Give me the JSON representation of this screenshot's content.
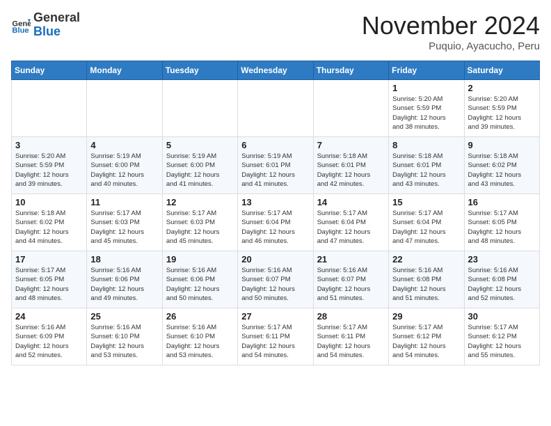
{
  "header": {
    "logo_general": "General",
    "logo_blue": "Blue",
    "month_title": "November 2024",
    "subtitle": "Puquio, Ayacucho, Peru"
  },
  "weekdays": [
    "Sunday",
    "Monday",
    "Tuesday",
    "Wednesday",
    "Thursday",
    "Friday",
    "Saturday"
  ],
  "weeks": [
    [
      {
        "day": "",
        "info": ""
      },
      {
        "day": "",
        "info": ""
      },
      {
        "day": "",
        "info": ""
      },
      {
        "day": "",
        "info": ""
      },
      {
        "day": "",
        "info": ""
      },
      {
        "day": "1",
        "info": "Sunrise: 5:20 AM\nSunset: 5:59 PM\nDaylight: 12 hours\nand 38 minutes."
      },
      {
        "day": "2",
        "info": "Sunrise: 5:20 AM\nSunset: 5:59 PM\nDaylight: 12 hours\nand 39 minutes."
      }
    ],
    [
      {
        "day": "3",
        "info": "Sunrise: 5:20 AM\nSunset: 5:59 PM\nDaylight: 12 hours\nand 39 minutes."
      },
      {
        "day": "4",
        "info": "Sunrise: 5:19 AM\nSunset: 6:00 PM\nDaylight: 12 hours\nand 40 minutes."
      },
      {
        "day": "5",
        "info": "Sunrise: 5:19 AM\nSunset: 6:00 PM\nDaylight: 12 hours\nand 41 minutes."
      },
      {
        "day": "6",
        "info": "Sunrise: 5:19 AM\nSunset: 6:01 PM\nDaylight: 12 hours\nand 41 minutes."
      },
      {
        "day": "7",
        "info": "Sunrise: 5:18 AM\nSunset: 6:01 PM\nDaylight: 12 hours\nand 42 minutes."
      },
      {
        "day": "8",
        "info": "Sunrise: 5:18 AM\nSunset: 6:01 PM\nDaylight: 12 hours\nand 43 minutes."
      },
      {
        "day": "9",
        "info": "Sunrise: 5:18 AM\nSunset: 6:02 PM\nDaylight: 12 hours\nand 43 minutes."
      }
    ],
    [
      {
        "day": "10",
        "info": "Sunrise: 5:18 AM\nSunset: 6:02 PM\nDaylight: 12 hours\nand 44 minutes."
      },
      {
        "day": "11",
        "info": "Sunrise: 5:17 AM\nSunset: 6:03 PM\nDaylight: 12 hours\nand 45 minutes."
      },
      {
        "day": "12",
        "info": "Sunrise: 5:17 AM\nSunset: 6:03 PM\nDaylight: 12 hours\nand 45 minutes."
      },
      {
        "day": "13",
        "info": "Sunrise: 5:17 AM\nSunset: 6:04 PM\nDaylight: 12 hours\nand 46 minutes."
      },
      {
        "day": "14",
        "info": "Sunrise: 5:17 AM\nSunset: 6:04 PM\nDaylight: 12 hours\nand 47 minutes."
      },
      {
        "day": "15",
        "info": "Sunrise: 5:17 AM\nSunset: 6:04 PM\nDaylight: 12 hours\nand 47 minutes."
      },
      {
        "day": "16",
        "info": "Sunrise: 5:17 AM\nSunset: 6:05 PM\nDaylight: 12 hours\nand 48 minutes."
      }
    ],
    [
      {
        "day": "17",
        "info": "Sunrise: 5:17 AM\nSunset: 6:05 PM\nDaylight: 12 hours\nand 48 minutes."
      },
      {
        "day": "18",
        "info": "Sunrise: 5:16 AM\nSunset: 6:06 PM\nDaylight: 12 hours\nand 49 minutes."
      },
      {
        "day": "19",
        "info": "Sunrise: 5:16 AM\nSunset: 6:06 PM\nDaylight: 12 hours\nand 50 minutes."
      },
      {
        "day": "20",
        "info": "Sunrise: 5:16 AM\nSunset: 6:07 PM\nDaylight: 12 hours\nand 50 minutes."
      },
      {
        "day": "21",
        "info": "Sunrise: 5:16 AM\nSunset: 6:07 PM\nDaylight: 12 hours\nand 51 minutes."
      },
      {
        "day": "22",
        "info": "Sunrise: 5:16 AM\nSunset: 6:08 PM\nDaylight: 12 hours\nand 51 minutes."
      },
      {
        "day": "23",
        "info": "Sunrise: 5:16 AM\nSunset: 6:08 PM\nDaylight: 12 hours\nand 52 minutes."
      }
    ],
    [
      {
        "day": "24",
        "info": "Sunrise: 5:16 AM\nSunset: 6:09 PM\nDaylight: 12 hours\nand 52 minutes."
      },
      {
        "day": "25",
        "info": "Sunrise: 5:16 AM\nSunset: 6:10 PM\nDaylight: 12 hours\nand 53 minutes."
      },
      {
        "day": "26",
        "info": "Sunrise: 5:16 AM\nSunset: 6:10 PM\nDaylight: 12 hours\nand 53 minutes."
      },
      {
        "day": "27",
        "info": "Sunrise: 5:17 AM\nSunset: 6:11 PM\nDaylight: 12 hours\nand 54 minutes."
      },
      {
        "day": "28",
        "info": "Sunrise: 5:17 AM\nSunset: 6:11 PM\nDaylight: 12 hours\nand 54 minutes."
      },
      {
        "day": "29",
        "info": "Sunrise: 5:17 AM\nSunset: 6:12 PM\nDaylight: 12 hours\nand 54 minutes."
      },
      {
        "day": "30",
        "info": "Sunrise: 5:17 AM\nSunset: 6:12 PM\nDaylight: 12 hours\nand 55 minutes."
      }
    ]
  ]
}
